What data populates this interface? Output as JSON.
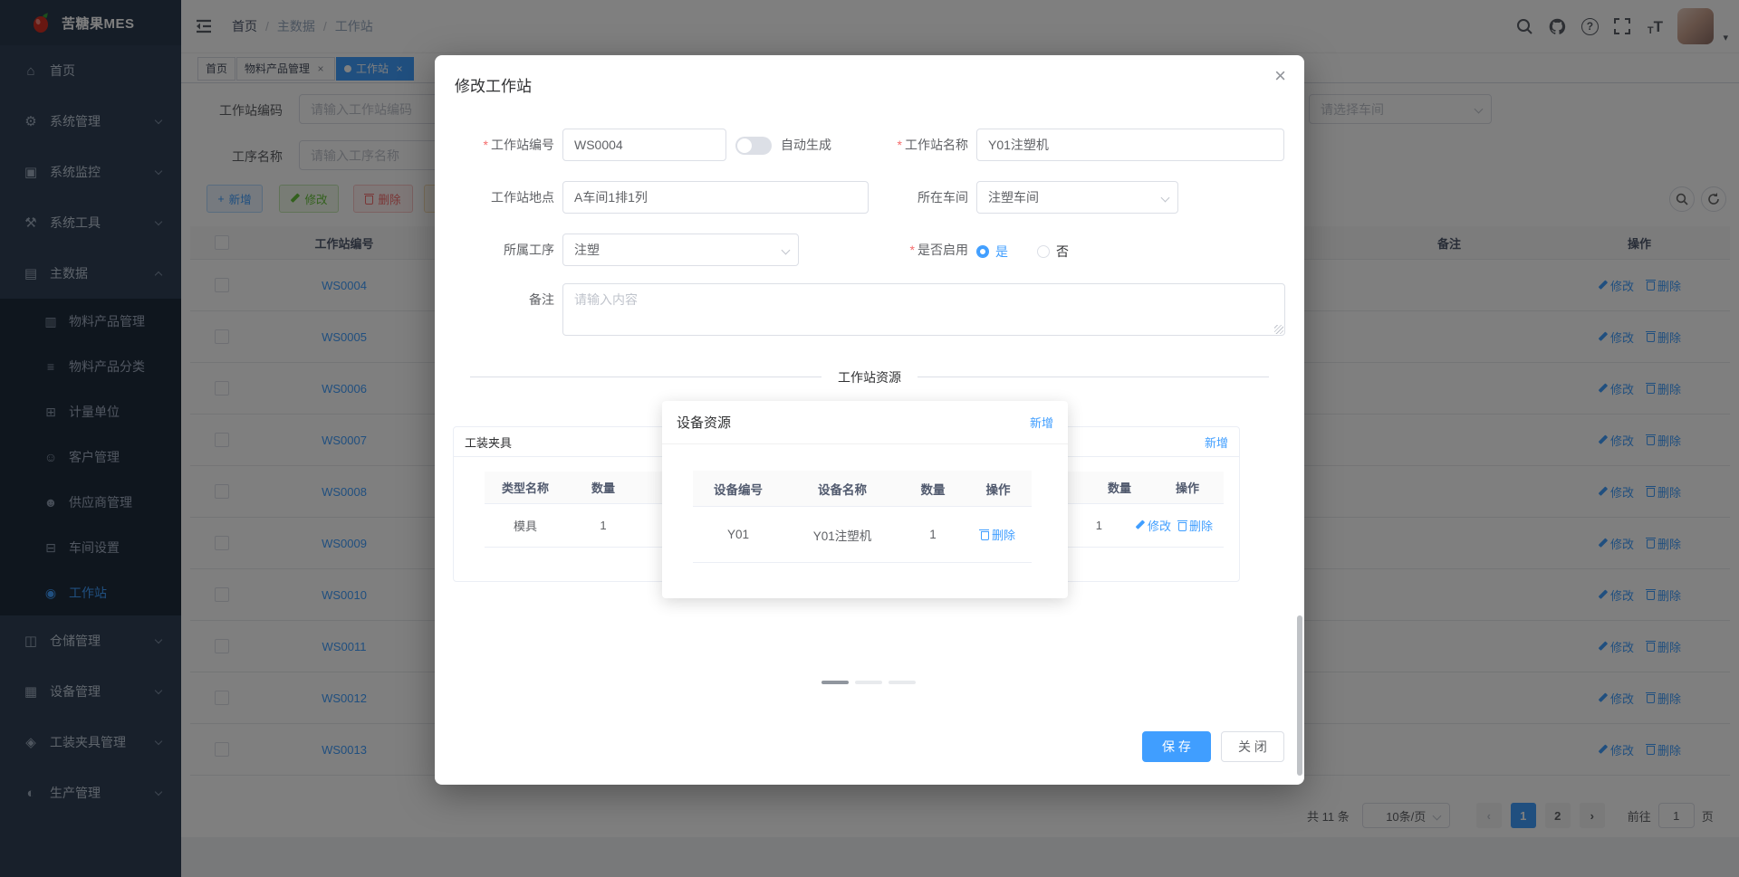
{
  "brand": {
    "name": "苦糖果MES"
  },
  "sidebar": {
    "items": [
      {
        "label": "首页"
      },
      {
        "label": "系统管理"
      },
      {
        "label": "系统监控"
      },
      {
        "label": "系统工具"
      },
      {
        "label": "主数据"
      },
      {
        "label": "仓储管理"
      },
      {
        "label": "设备管理"
      },
      {
        "label": "工装夹具管理"
      },
      {
        "label": "生产管理"
      }
    ],
    "children": [
      "物料产品管理",
      "物料产品分类",
      "计量单位",
      "客户管理",
      "供应商管理",
      "车间设置",
      "工作站"
    ],
    "active_item": "工作站"
  },
  "navbar": {
    "breadcrumb": [
      "首页",
      "主数据",
      "工作站"
    ]
  },
  "tabs": [
    "首页",
    "物料产品管理",
    "工作站"
  ],
  "filters": {
    "station_code_label": "工作站编码",
    "station_code_placeholder": "请输入工作站编码",
    "process_name_label": "工序名称",
    "process_name_placeholder": "请输入工序名称",
    "workshop_placeholder": "请选择车间"
  },
  "toolbar": {
    "add": "新增",
    "edit": "修改",
    "delete": "删除"
  },
  "table": {
    "headers": {
      "code": "工作站编号",
      "remark": "备注",
      "actions": "操作"
    },
    "rows": [
      "WS0004",
      "WS0005",
      "WS0006",
      "WS0007",
      "WS0008",
      "WS0009",
      "WS0010",
      "WS0011",
      "WS0012",
      "WS0013"
    ],
    "row_edit": "修改",
    "row_delete": "删除"
  },
  "pagination": {
    "total": "共 11 条",
    "page_size": "10条/页",
    "page1": "1",
    "page2": "2",
    "goto_label": "前往",
    "goto_value": "1",
    "page_unit": "页"
  },
  "dialog": {
    "title": "修改工作站",
    "fields": {
      "code_label": "工作站编号",
      "code_value": "WS0004",
      "auto_generate": "自动生成",
      "name_label": "工作站名称",
      "name_value": "Y01注塑机",
      "location_label": "工作站地点",
      "location_value": "A车间1排1列",
      "workshop_label": "所在车间",
      "workshop_value": "注塑车间",
      "process_label": "所属工序",
      "process_value": "注塑",
      "enabled_label": "是否启用",
      "enabled_yes": "是",
      "enabled_no": "否",
      "remark_label": "备注",
      "remark_placeholder": "请输入内容"
    },
    "section_title": "工作站资源",
    "fixture_card": {
      "title": "工装夹具",
      "headers": {
        "type": "类型名称",
        "qty": "数量"
      },
      "row": {
        "type": "模具",
        "qty": "1",
        "edit": "修改"
      }
    },
    "equipment_popup": {
      "title": "设备资源",
      "add": "新增",
      "headers": {
        "code": "设备编号",
        "name": "设备名称",
        "qty": "数量",
        "actions": "操作"
      },
      "row": {
        "code": "Y01",
        "name": "Y01注塑机",
        "qty": "1",
        "delete": "删除"
      }
    },
    "right_card": {
      "add": "新增",
      "headers": {
        "qty": "数量",
        "actions": "操作"
      },
      "row": {
        "qty": "1",
        "edit": "修改",
        "delete": "删除"
      }
    },
    "save": "保 存",
    "close": "关 闭"
  }
}
